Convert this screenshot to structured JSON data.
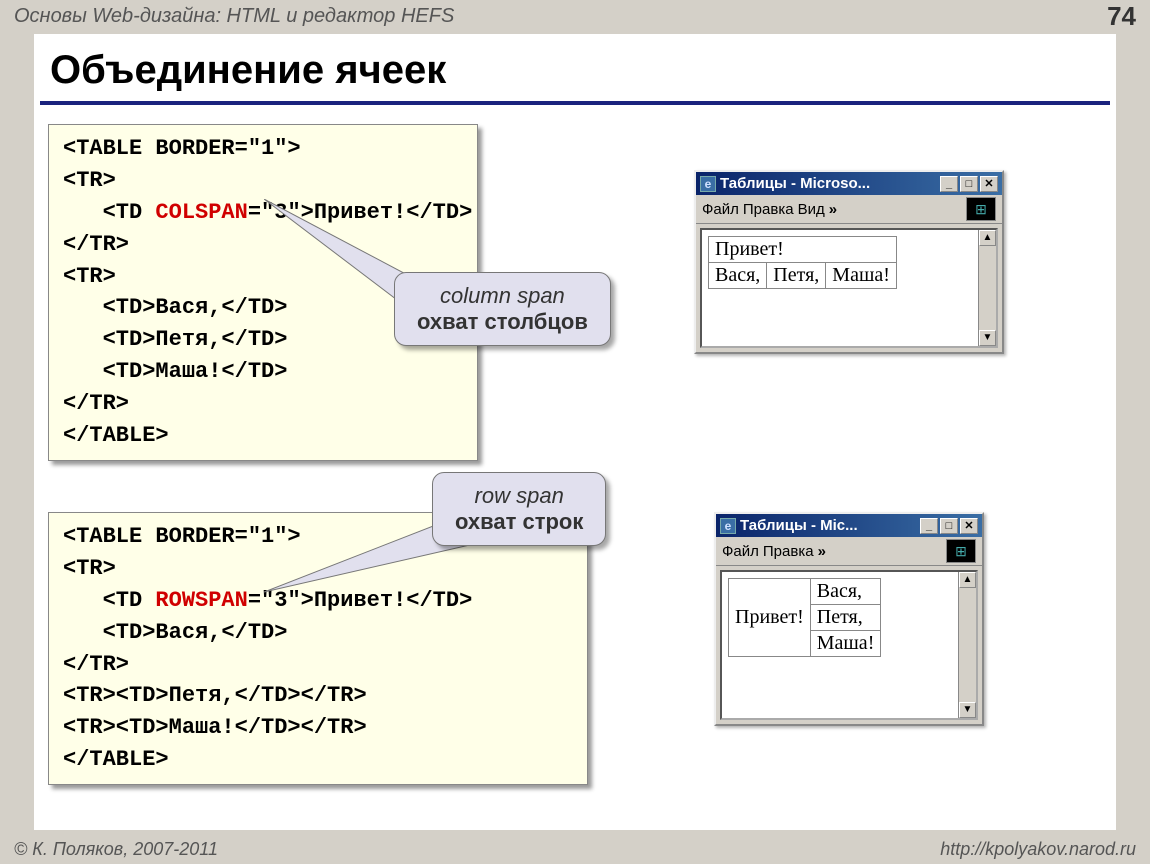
{
  "header": {
    "course": "Основы Web-дизайна: HTML и редактор HEFS",
    "page": "74"
  },
  "title": "Объединение ячеек",
  "code1": {
    "l1": "<TABLE BORDER=\"1\">",
    "l2": "<TR>",
    "l3a": "   <TD ",
    "l3kw": "COLSPAN",
    "l3b": "=\"3\">Привет!</TD>",
    "l4": "</TR>",
    "l5": "<TR>",
    "l6": "   <TD>Вася,</TD>",
    "l7": "   <TD>Петя,</TD>",
    "l8": "   <TD>Маша!</TD>",
    "l9": "</TR>",
    "l10": "</TABLE>"
  },
  "callout1": {
    "line1": "column span",
    "line2": "охват столбцов"
  },
  "code2": {
    "l1": "<TABLE BORDER=\"1\">",
    "l2": "<TR>",
    "l3a": "   <TD ",
    "l3kw": "ROWSPAN",
    "l3b": "=\"3\">Привет!</TD>",
    "l4": "   <TD>Вася,</TD>",
    "l5": "</TR>",
    "l6": "<TR><TD>Петя,</TD></TR>",
    "l7": "<TR><TD>Маша!</TD></TR>",
    "l8": "</TABLE>"
  },
  "callout2": {
    "line1": "row span",
    "line2": "охват строк"
  },
  "ie1": {
    "title": "Таблицы - Microso...",
    "menu": {
      "file": "Файл",
      "edit": "Правка",
      "view": "Вид",
      "chev": "»"
    },
    "cells": {
      "r1c1": "Привет!",
      "r2c1": "Вася,",
      "r2c2": "Петя,",
      "r2c3": "Маша!"
    }
  },
  "ie2": {
    "title": "Таблицы - Mic...",
    "menu": {
      "file": "Файл",
      "edit": "Правка",
      "chev": "»"
    },
    "cells": {
      "r1c1": "Привет!",
      "r1c2": "Вася,",
      "r2c2": "Петя,",
      "r3c2": "Маша!"
    }
  },
  "footer": {
    "left": "© К. Поляков, 2007-2011",
    "right": "http://kpolyakov.narod.ru"
  }
}
